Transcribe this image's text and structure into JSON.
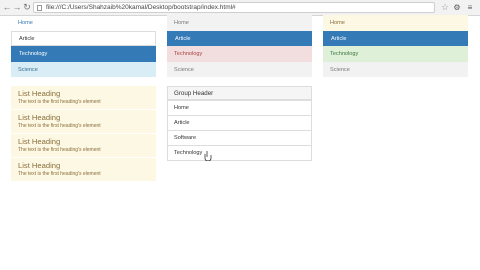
{
  "browser": {
    "url": "file:///C:/Users/Shahzaib%20kamal/Desktop/bootstrap/index.html#",
    "icons": [
      "back-icon",
      "forward-icon",
      "reload-icon",
      "star-icon",
      "extension-icon",
      "menu-icon"
    ]
  },
  "col1": {
    "items": [
      "Home",
      "Article",
      "Technology",
      "Science"
    ],
    "headings": [
      {
        "title": "List Heading",
        "text": "The text is the first heading's element"
      },
      {
        "title": "List Heading",
        "text": "The text is the first heading's element"
      },
      {
        "title": "List Heading",
        "text": "The text is the first heading's element"
      },
      {
        "title": "List Heading",
        "text": "The text is the first heading's element"
      }
    ]
  },
  "col2": {
    "items": [
      "Home",
      "Article",
      "Technology",
      "Science"
    ],
    "panel_header": "Group Header",
    "panel_items": [
      "Home",
      "Article",
      "Software",
      "Technology"
    ]
  },
  "col3": {
    "items": [
      "Home",
      "Article",
      "Technology",
      "Science"
    ]
  },
  "colors": {
    "active": "#337ab7",
    "info": "#d9edf7",
    "danger": "#f2dede",
    "success": "#dff0d8",
    "warning": "#fcf8e3"
  }
}
